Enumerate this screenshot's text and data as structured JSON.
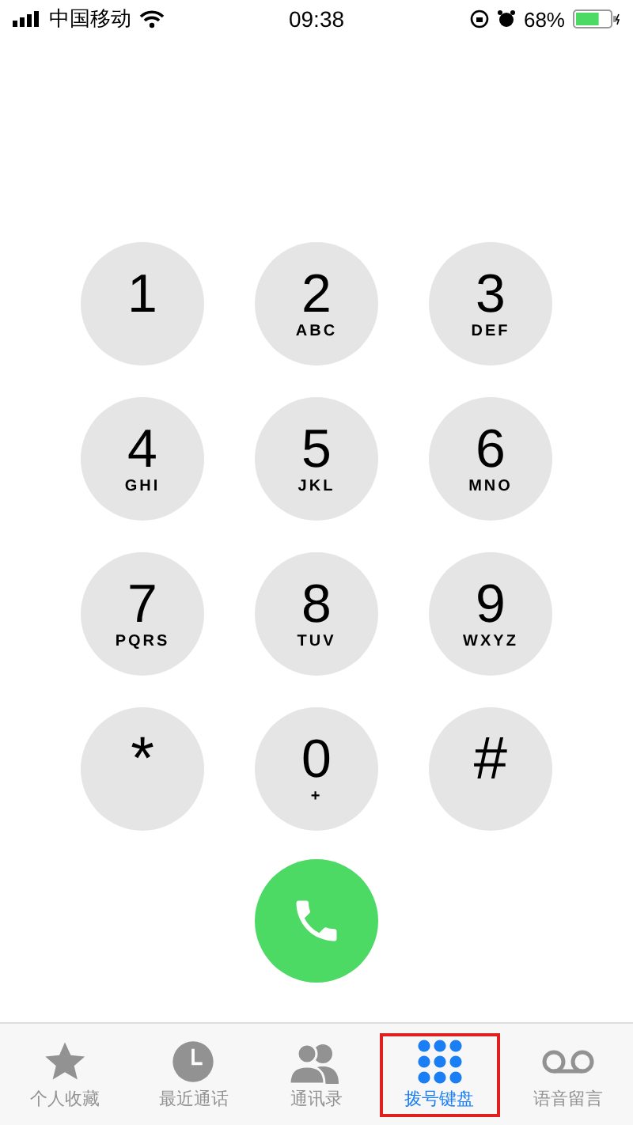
{
  "status_bar": {
    "carrier": "中国移动",
    "time": "09:38",
    "battery": "68%"
  },
  "keys": [
    {
      "digit": "1"
    },
    {
      "digit": "2",
      "letters": "ABC"
    },
    {
      "digit": "3",
      "letters": "DEF"
    },
    {
      "digit": "4",
      "letters": "GHI"
    },
    {
      "digit": "5",
      "letters": "JKL"
    },
    {
      "digit": "6",
      "letters": "MNO"
    },
    {
      "digit": "7",
      "letters": "PQRS"
    },
    {
      "digit": "8",
      "letters": "TUV"
    },
    {
      "digit": "9",
      "letters": "WXYZ"
    },
    {
      "digit": "*"
    },
    {
      "digit": "0",
      "letters": "+"
    },
    {
      "digit": "#"
    }
  ],
  "tabs": [
    {
      "kind": "star",
      "label": "个人收藏",
      "selected": false,
      "highlighted": false
    },
    {
      "kind": "clock",
      "label": "最近通话",
      "selected": false,
      "highlighted": false
    },
    {
      "kind": "contacts",
      "label": "通讯录",
      "selected": false,
      "highlighted": false
    },
    {
      "kind": "keypad",
      "label": "拨号键盘",
      "selected": true,
      "highlighted": true
    },
    {
      "kind": "voicemail",
      "label": "语音留言",
      "selected": false,
      "highlighted": false
    }
  ]
}
